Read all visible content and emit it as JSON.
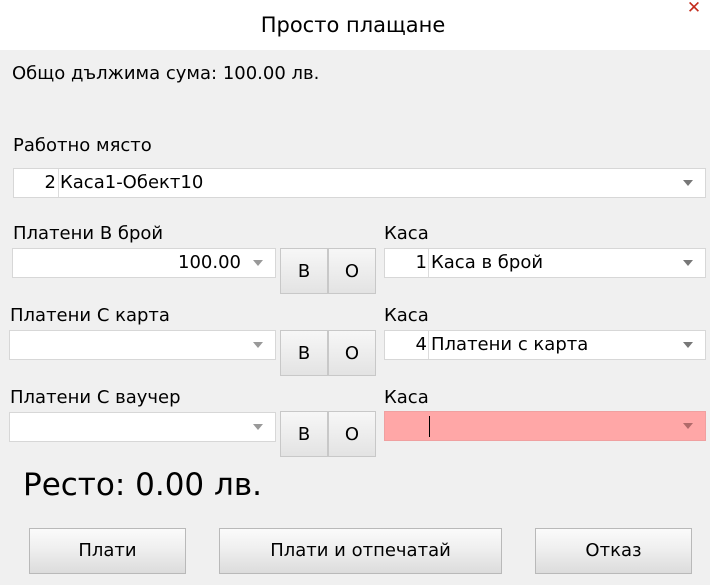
{
  "window": {
    "title": "Просто плащане",
    "close_glyph": "✕"
  },
  "total_due": "Общо дължима сума: 100.00 лв.",
  "workplace": {
    "label": "Работно място",
    "number": "2",
    "name": "Каса1-Обект10"
  },
  "payments": [
    {
      "label": "Платени В брой",
      "amount": "100.00",
      "btn_b": "В",
      "btn_o": "О",
      "register_label": "Каса",
      "register_number": "1",
      "register_name": "Каса в брой"
    },
    {
      "label": "Платени С карта",
      "amount": "",
      "btn_b": "В",
      "btn_o": "О",
      "register_label": "Каса",
      "register_number": "4",
      "register_name": "Платени с карта"
    },
    {
      "label": "Платени С ваучер",
      "amount": "",
      "btn_b": "В",
      "btn_o": "О",
      "register_label": "Каса",
      "register_number": "",
      "register_name": ""
    }
  ],
  "change": "Ресто: 0.00 лв.",
  "buttons": {
    "pay": "Плати",
    "pay_print": "Плати и отпечатай",
    "cancel": "Отказ"
  },
  "colors": {
    "error_field": "#ffa7a7",
    "close": "#c42b1c"
  }
}
